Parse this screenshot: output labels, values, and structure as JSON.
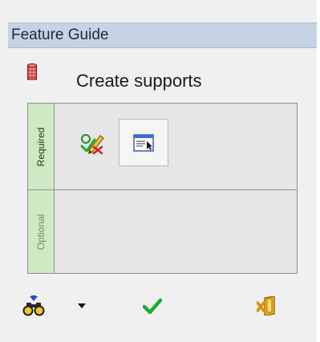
{
  "panel": {
    "title": "Feature Guide"
  },
  "header": {
    "feature_title": "Create supports",
    "icon": "support-cylinder-icon"
  },
  "sections": {
    "required": {
      "label": "Required"
    },
    "optional": {
      "label": "Optional"
    }
  },
  "tools": [
    {
      "icon": "edit-pencil-check-icon"
    },
    {
      "icon": "window-selector-icon"
    }
  ],
  "bottom_bar": {
    "icons": [
      "binoculars-find-icon",
      "dropdown-arrow-icon",
      "green-check-icon",
      "exit-door-icon"
    ]
  },
  "colors": {
    "titlebar": "#c5d3e5",
    "section_tab": "#cfe9c4",
    "check": "#1faa33",
    "exit": "#f0a100",
    "binoculars": "#1f4fd0"
  }
}
